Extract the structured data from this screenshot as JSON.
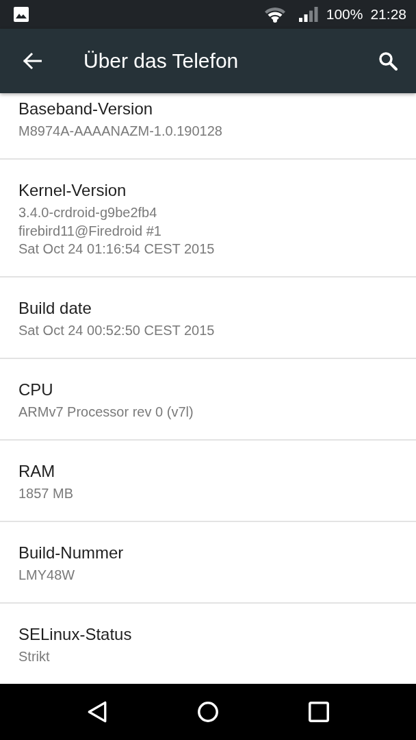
{
  "status_bar": {
    "battery": "100%",
    "time": "21:28"
  },
  "toolbar": {
    "title": "Über das Telefon"
  },
  "items": [
    {
      "title": "Baseband-Version",
      "value_lines": [
        "M8974A-AAAANAZM-1.0.190128"
      ]
    },
    {
      "title": "Kernel-Version",
      "value_lines": [
        "3.4.0-crdroid-g9be2fb4",
        "firebird11@Firedroid #1",
        "Sat Oct 24 01:16:54 CEST 2015"
      ]
    },
    {
      "title": "Build date",
      "value_lines": [
        "Sat Oct 24 00:52:50 CEST 2015"
      ]
    },
    {
      "title": "CPU",
      "value_lines": [
        "ARMv7 Processor rev 0 (v7l)"
      ]
    },
    {
      "title": "RAM",
      "value_lines": [
        "1857 MB"
      ]
    },
    {
      "title": "Build-Nummer",
      "value_lines": [
        "LMY48W"
      ]
    },
    {
      "title": "SELinux-Status",
      "value_lines": [
        "Strikt"
      ]
    }
  ]
}
